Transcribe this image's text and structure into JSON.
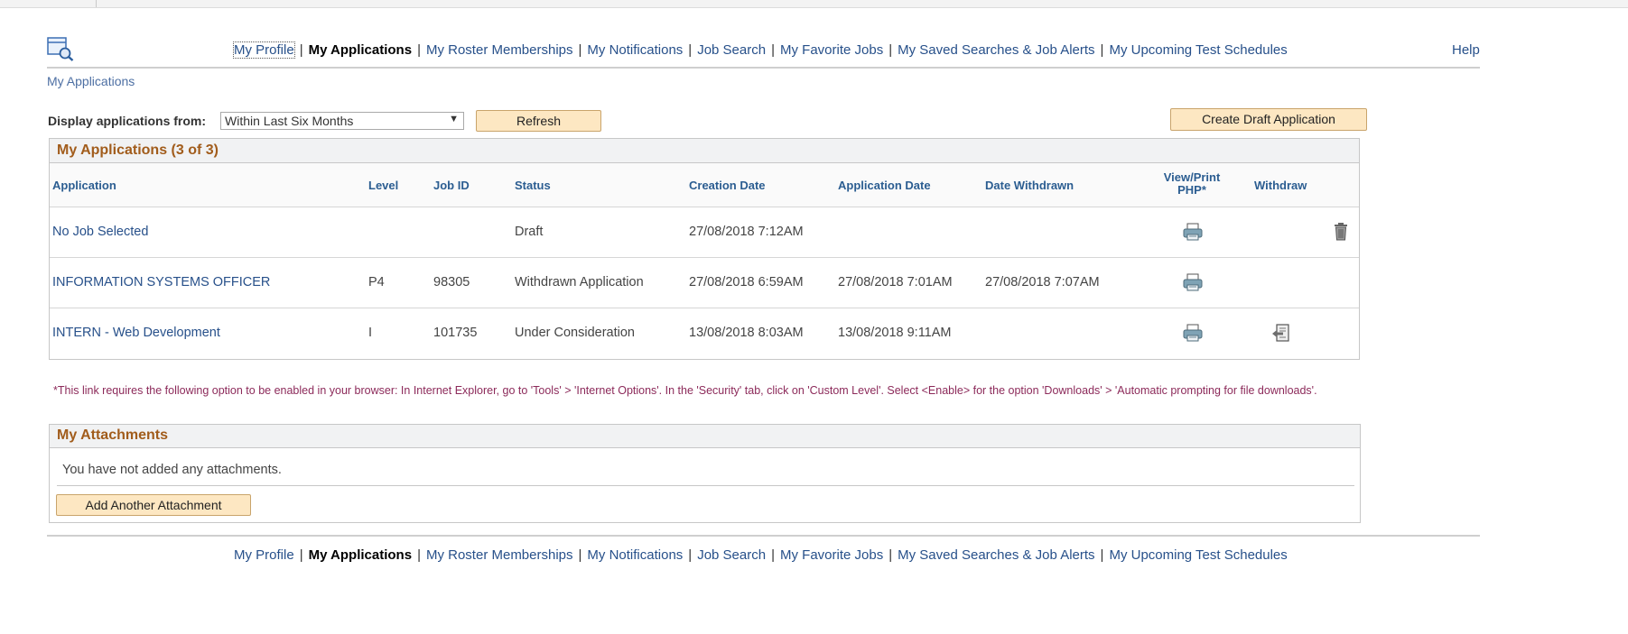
{
  "nav": {
    "items": [
      {
        "label": "My Profile"
      },
      {
        "label": "My Applications"
      },
      {
        "label": "My Roster Memberships"
      },
      {
        "label": "My Notifications"
      },
      {
        "label": "Job Search"
      },
      {
        "label": "My Favorite Jobs"
      },
      {
        "label": "My Saved Searches & Job Alerts"
      },
      {
        "label": "My Upcoming Test Schedules"
      }
    ],
    "help": "Help"
  },
  "breadcrumb": "My Applications",
  "filter": {
    "label": "Display applications from:",
    "selected": "Within Last Six Months",
    "refresh": "Refresh"
  },
  "create_draft": "Create Draft Application",
  "applications": {
    "title": "My Applications (3 of 3)",
    "columns": {
      "application": "Application",
      "level": "Level",
      "job_id": "Job ID",
      "status": "Status",
      "creation_date": "Creation Date",
      "application_date": "Application Date",
      "date_withdrawn": "Date Withdrawn",
      "view_print": "View/Print",
      "view_print_2": "PHP*",
      "withdraw": "Withdraw"
    },
    "rows": [
      {
        "application": "No Job Selected",
        "level": "",
        "job_id": "",
        "status": "Draft",
        "creation_date": "27/08/2018  7:12AM",
        "application_date": "",
        "date_withdrawn": "",
        "print_icon": "printer-icon",
        "action_icon": "trash-icon"
      },
      {
        "application": "INFORMATION SYSTEMS OFFICER",
        "level": "P4",
        "job_id": "98305",
        "status": "Withdrawn Application",
        "creation_date": "27/08/2018  6:59AM",
        "application_date": "27/08/2018  7:01AM",
        "date_withdrawn": "27/08/2018  7:07AM",
        "print_icon": "printer-icon",
        "action_icon": ""
      },
      {
        "application": "INTERN - Web Development",
        "level": "I",
        "job_id": "101735",
        "status": "Under Consideration",
        "creation_date": "13/08/2018  8:03AM",
        "application_date": "13/08/2018  9:11AM",
        "date_withdrawn": "",
        "print_icon": "printer-icon",
        "action_icon": "withdraw-icon"
      }
    ]
  },
  "note": "*This link requires the following option to be enabled in your browser: In Internet Explorer, go to 'Tools' > 'Internet Options'. In the 'Security' tab, click on 'Custom Level'. Select <Enable> for the option 'Downloads' > 'Automatic prompting for file downloads'.",
  "attachments": {
    "title": "My Attachments",
    "empty_text": "You have not added any attachments.",
    "add_button": "Add Another Attachment"
  },
  "colors": {
    "link": "#27508a",
    "section_title": "#a15c1b",
    "button_bg": "#fde7c2",
    "note": "#8c2a5a"
  }
}
